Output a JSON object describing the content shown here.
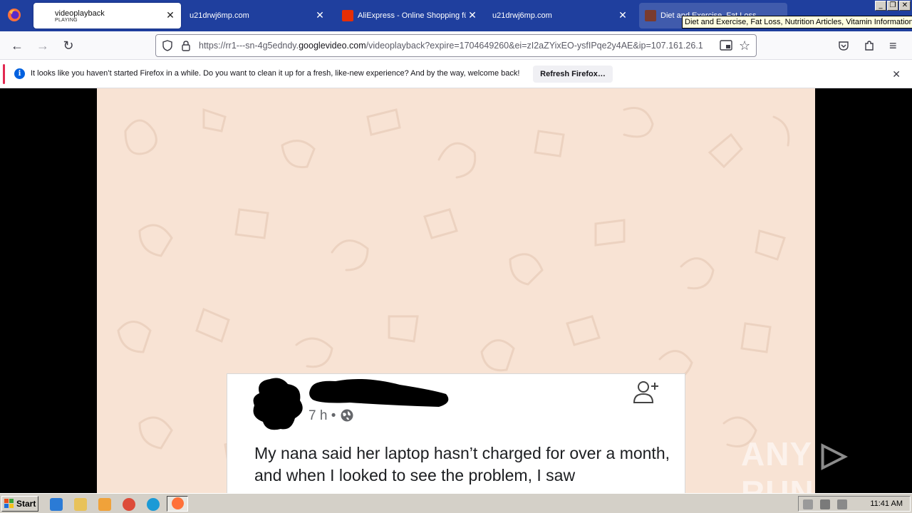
{
  "browser": {
    "tabs": [
      {
        "title": "videoplayback",
        "subtitle": "PLAYING",
        "active": true
      },
      {
        "title": "u21drwj6mp.com",
        "active": false
      },
      {
        "title": "AliExpress - Online Shopping für",
        "active": false
      },
      {
        "title": "u21drwj6mp.com",
        "active": false
      },
      {
        "title": "Diet and Exercise, Fat Loss",
        "active": false
      }
    ],
    "tooltip": "Diet and Exercise, Fat Loss, Nutrition Articles, Vitamin Information",
    "window_buttons": {
      "minimize": "_",
      "maximize": "❐",
      "close": "✕"
    }
  },
  "navbar": {
    "url_prefix": "https://rr1---sn-4g5edndy.",
    "url_domain": "googlevideo.com",
    "url_suffix": "/videoplayback?expire=1704649260&ei=zI2aZYixEO-ysfIPqe2y4AE&ip=107.161.26.1"
  },
  "notification": {
    "message": "It looks like you haven’t started Firefox in a while. Do you want to clean it up for a fresh, like-new experience? And by the way, welcome back!",
    "button_label": "Refresh Firefox…"
  },
  "video": {
    "post_time": "7 h •",
    "post_text": "My nana said her laptop hasn’t charged for over a month, and when I looked to see the problem, I saw",
    "watermark": "ANY ▷ RUN"
  },
  "taskbar": {
    "start_label": "Start",
    "clock": "11:41 AM"
  },
  "colors": {
    "tabstrip": "#1f3f9e",
    "video_background": "#f8e3d4",
    "notification_accent": "#e22850"
  }
}
